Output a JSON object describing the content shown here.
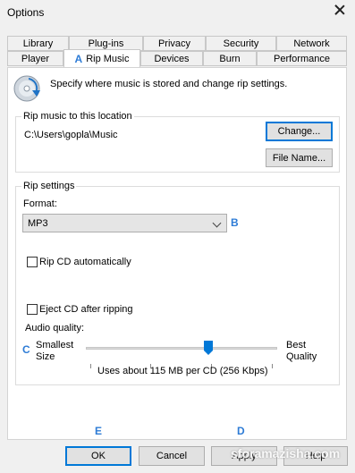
{
  "window": {
    "title": "Options"
  },
  "tabs_row1": [
    "Library",
    "Plug-ins",
    "Privacy",
    "Security",
    "Network"
  ],
  "tabs_row2": [
    "Player",
    "Rip Music",
    "Devices",
    "Burn",
    "Performance"
  ],
  "active_tab": "Rip Music",
  "markers": {
    "a": "A",
    "b": "B",
    "c": "C",
    "d": "D",
    "e": "E"
  },
  "header": {
    "description": "Specify where music is stored and change rip settings.",
    "icon": "rip-disc-icon"
  },
  "location": {
    "group_label": "Rip music to this location",
    "path": "C:\\Users\\gopla\\Music",
    "change_button": "Change...",
    "filename_button": "File Name..."
  },
  "rip_settings": {
    "group_label": "Rip settings",
    "format_label": "Format:",
    "format_value": "MP3",
    "rip_cd_auto": {
      "label": "Rip CD automatically",
      "checked": false
    },
    "eject_cd": {
      "label": "Eject CD after ripping",
      "checked": false
    },
    "audio_quality_label": "Audio quality:",
    "smallest_size": [
      "Smallest",
      "Size"
    ],
    "best_quality": [
      "Best",
      "Quality"
    ],
    "quality_level_fraction": 0.65,
    "usage_text": "Uses about 115 MB per CD (256 Kbps)"
  },
  "footer": {
    "ok": "OK",
    "cancel": "Cancel",
    "apply": "Apply",
    "help": "Help"
  },
  "watermark": "sforamazisha.com",
  "colors": {
    "accent": "#0078d7",
    "marker": "#2e7cd6"
  }
}
